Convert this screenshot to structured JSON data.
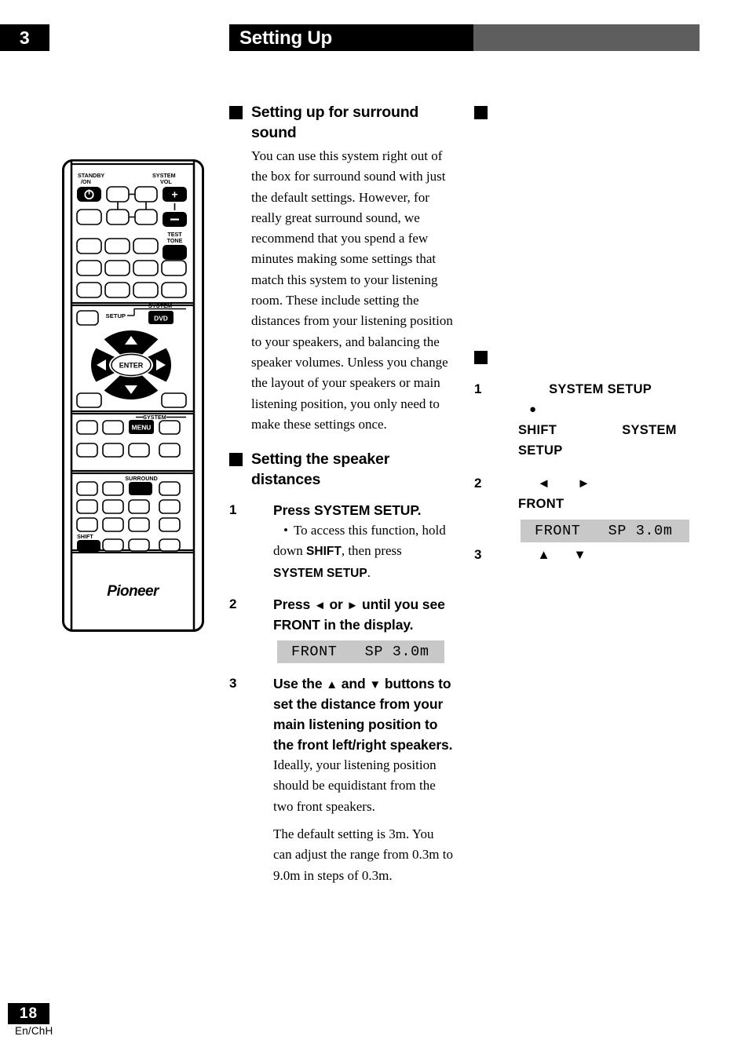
{
  "header": {
    "chapter_number": "3",
    "title": "Setting Up",
    "bar_black_color": "#000000",
    "bar_gray_color": "#5e5e5e"
  },
  "footer": {
    "page_number": "18",
    "language_code": "En/ChH"
  },
  "left_column": {
    "section1": {
      "heading": "Setting up for surround sound",
      "paragraph": "You can use this system right out of the box for surround sound with just the default settings. However, for really great surround sound, we recommend that you spend a few minutes making some settings that match this system to your listening room. These include setting the distances from your listening position to your speakers, and balancing the speaker volumes. Unless you change the layout of your speakers or main listening position, you only need to make these settings once."
    },
    "section2": {
      "heading": "Setting the speaker distances",
      "steps": [
        {
          "number": "1",
          "head": "Press SYSTEM SETUP.",
          "bullet_dot": "•",
          "bullet_text_part1": "To access this function, hold down ",
          "bullet_bold1": "SHIFT",
          "bullet_text_part2": ", then press ",
          "bullet_bold2": "SYSTEM SETUP",
          "bullet_text_part3": "."
        },
        {
          "number": "2",
          "head_part1": "Press ",
          "head_arrow_left": "◄",
          "head_part2": " or ",
          "head_arrow_right": "►",
          "head_part3": " until you see FRONT in the display.",
          "lcd": "FRONT   SP 3.0m"
        },
        {
          "number": "3",
          "head_part1": "Use the ",
          "head_arrow_up": "▲",
          "head_part2": " and ",
          "head_arrow_down": "▼",
          "head_part3": " buttons to set the distance from your main listening position to the front left/right speakers.",
          "body1": "Ideally, your listening position should be equidistant from the two front speakers.",
          "body2": "The default setting is 3m. You can adjust  the range from 0.3m to 9.0m in steps of 0.3m."
        }
      ]
    }
  },
  "right_column": {
    "section1": {
      "heading": ""
    },
    "section2": {
      "heading": "",
      "steps": [
        {
          "number": "1",
          "head": "        SYSTEM SETUP",
          "bullet_dot": "●",
          "line_shift_system": "SHIFT                 SYSTEM",
          "line_setup": "SETUP"
        },
        {
          "number": "2",
          "arrows": "     ◄       ►",
          "front_label": "FRONT",
          "lcd": "FRONT   SP 3.0m"
        },
        {
          "number": "3",
          "arrows": "     ▲      ▼"
        }
      ]
    }
  },
  "remote": {
    "labels": {
      "standby_on": "STANDBY\n/ON",
      "standby_line1": "STANDBY",
      "standby_line2": "/ON",
      "system_vol_line1": "SYSTEM",
      "system_vol_line2": "VOL",
      "vol_up": "+",
      "vol_down": "–",
      "test_tone_line1": "TEST",
      "test_tone_line2": "TONE",
      "setup": "SETUP",
      "system_small": "SYSTEM",
      "dvd": "DVD",
      "enter": "ENTER",
      "system_menu_group": "SYSTEM",
      "menu": "MENU",
      "surround": "SURROUND",
      "shift": "SHIFT",
      "brand": "Pioneer"
    }
  }
}
